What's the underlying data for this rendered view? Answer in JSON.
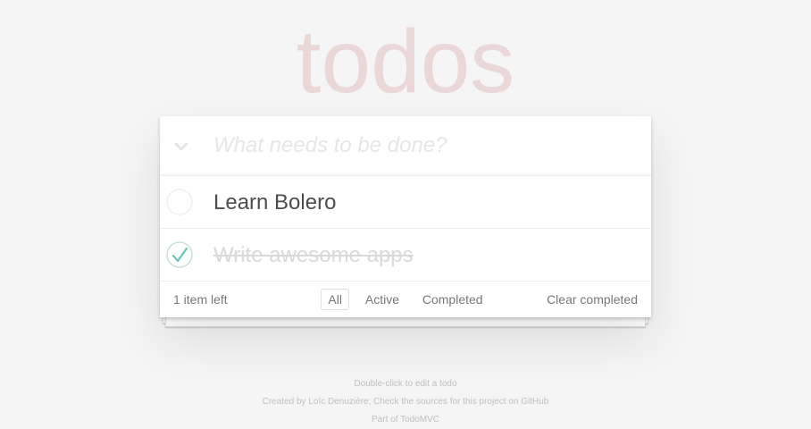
{
  "app": {
    "title": "todos"
  },
  "input": {
    "placeholder": "What needs to be done?",
    "value": ""
  },
  "toggle_all_icon": "chevron-down-icon",
  "todos": [
    {
      "label": "Learn Bolero",
      "completed": false
    },
    {
      "label": "Write awesome apps",
      "completed": true
    }
  ],
  "footer": {
    "count_text": "1 item left",
    "filters": [
      {
        "label": "All",
        "selected": true
      },
      {
        "label": "Active",
        "selected": false
      },
      {
        "label": "Completed",
        "selected": false
      }
    ],
    "clear_label": "Clear completed"
  },
  "info": {
    "line1": "Double-click to edit a todo",
    "line2_prefix": "Created by ",
    "line2_author": "Loïc Denuzière",
    "line2_mid": "; Check the ",
    "line2_sources": "sources for this project on GitHub",
    "line3_prefix": "Part of ",
    "line3_link": "TodoMVC"
  },
  "colors": {
    "background": "#f5f5f5",
    "title": "#af2f2f",
    "check_green": "#5dc2af",
    "check_circle": "#bddad5",
    "unchecked_circle": "#ededed"
  }
}
